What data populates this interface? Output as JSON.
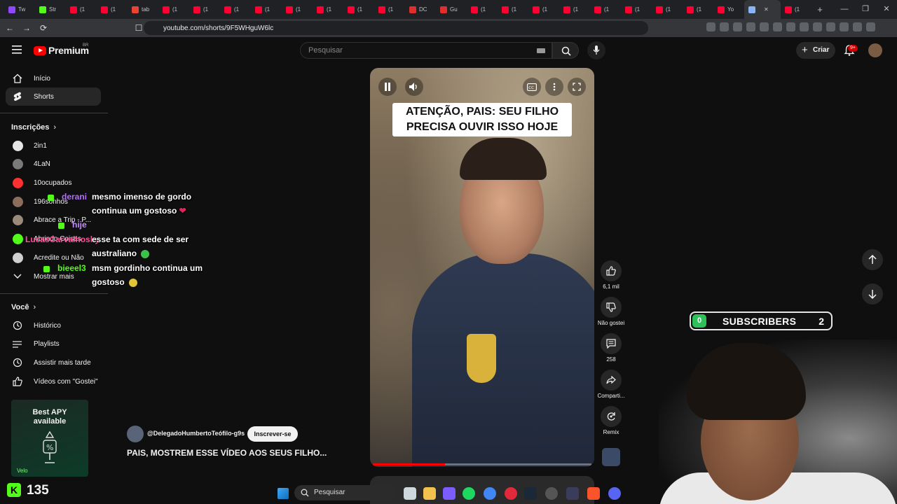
{
  "browser": {
    "tabs": [
      {
        "label": "Tw",
        "color": "#9146ff"
      },
      {
        "label": "Str",
        "color": "#53fc18"
      },
      {
        "label": "(1",
        "color": "#ff0033"
      },
      {
        "label": "(1",
        "color": "#ff0033"
      },
      {
        "label": "tab",
        "color": "#ea4335"
      },
      {
        "label": "(1",
        "color": "#ff0033"
      },
      {
        "label": "(1",
        "color": "#ff0033"
      },
      {
        "label": "(1",
        "color": "#ff0033"
      },
      {
        "label": "(1",
        "color": "#ff0033"
      },
      {
        "label": "(1",
        "color": "#ff0033"
      },
      {
        "label": "(1",
        "color": "#ff0033"
      },
      {
        "label": "(1",
        "color": "#ff0033"
      },
      {
        "label": "(1",
        "color": "#ff0033"
      },
      {
        "label": "DC",
        "color": "#e02d2d"
      },
      {
        "label": "Gu",
        "color": "#e02d2d"
      },
      {
        "label": "(1",
        "color": "#ff0033"
      },
      {
        "label": "(1",
        "color": "#ff0033"
      },
      {
        "label": "(1",
        "color": "#ff0033"
      },
      {
        "label": "(1",
        "color": "#ff0033"
      },
      {
        "label": "(1",
        "color": "#ff0033"
      },
      {
        "label": "(1",
        "color": "#ff0033"
      },
      {
        "label": "(1",
        "color": "#ff0033"
      },
      {
        "label": "(1",
        "color": "#ff0033"
      },
      {
        "label": "Yo",
        "color": "#ff0033"
      }
    ],
    "active_tab_close": "✕",
    "last_tab": {
      "label": "(1",
      "color": "#ff0033"
    },
    "new_tab": "+",
    "window_controls": [
      "—",
      "❐",
      "✕"
    ],
    "url": "youtube.com/shorts/9F5WHguW6lc"
  },
  "masthead": {
    "logo_text": "Premium",
    "logo_country": "BR",
    "search_placeholder": "Pesquisar",
    "create_label": "Criar",
    "create_icon": "+",
    "notif_count": "9+"
  },
  "sidebar": {
    "main": [
      {
        "label": "Início",
        "icon": "home-icon"
      },
      {
        "label": "Shorts",
        "icon": "shorts-icon",
        "active": true
      }
    ],
    "subs_title": "Inscrições",
    "subs": [
      {
        "label": "2in1",
        "color": "#e6e6e6"
      },
      {
        "label": "4LaN",
        "color": "#7a7a7a"
      },
      {
        "label": "10ocupados",
        "color": "#ff3030"
      },
      {
        "label": "196sonhos",
        "color": "#8a6d5a"
      },
      {
        "label": "Abrace a Trip - P...",
        "color": "#9a8a7a"
      },
      {
        "label": "Abrindo Coisas",
        "color": "#53fc18"
      },
      {
        "label": "Acredite ou Não",
        "color": "#cfcfcf"
      }
    ],
    "more_label": "Mostrar mais",
    "you_title": "Você",
    "you": [
      {
        "label": "Histórico",
        "icon": "history-icon"
      },
      {
        "label": "Playlists",
        "icon": "playlists-icon"
      },
      {
        "label": "Assistir mais tarde",
        "icon": "watch-later-icon"
      },
      {
        "label": "Vídeos com \"Gostei\"",
        "icon": "like-icon"
      }
    ]
  },
  "chat": [
    {
      "user": "derani",
      "color": "#b46cff",
      "text": "mesmo imenso de gordo",
      "emote": ""
    },
    {
      "user": "",
      "color": "",
      "text": "continua um gostoso",
      "emote": "❤"
    },
    {
      "user": "hije",
      "color": "#c58cff",
      "text": "",
      "emote": ""
    },
    {
      "user": "LucasCarvalhosky",
      "color": "#ff4f9a",
      "text": "esse ta com sede de ser",
      "emote": ""
    },
    {
      "user": "",
      "color": "",
      "text": "australiano",
      "emote": ""
    },
    {
      "user": "bieeel3",
      "color": "#53fc18",
      "text": "msm gordinho continua um",
      "emote": ""
    },
    {
      "user": "",
      "color": "",
      "text": "gostoso",
      "emote": ""
    }
  ],
  "video": {
    "caption_line1": "ATENÇÃO, PAIS: SEU FILHO",
    "caption_line2": "PRECISA OUVIR ISSO HOJE",
    "progress": 0.33
  },
  "actions": {
    "likes": "6,1 mil",
    "dislike": "Não gostei",
    "comments": "258",
    "share": "Comparti...",
    "remix": "Remix"
  },
  "channel": {
    "handle": "@DelegadoHumbertoTeófilo-g9s",
    "subscribe_label": "Inscrever-se",
    "title": "PAIS, MOSTREM ESSE VÍDEO AOS SEUS FILHO..."
  },
  "widget": {
    "current": "0",
    "label": "SUBSCRIBERS",
    "goal": "2"
  },
  "ad": {
    "line1": "Best APY",
    "line2": "available",
    "brand": "Velo"
  },
  "kick": {
    "count": "135",
    "logo": "K"
  },
  "taskbar": {
    "search_label": "Pesquisar"
  }
}
